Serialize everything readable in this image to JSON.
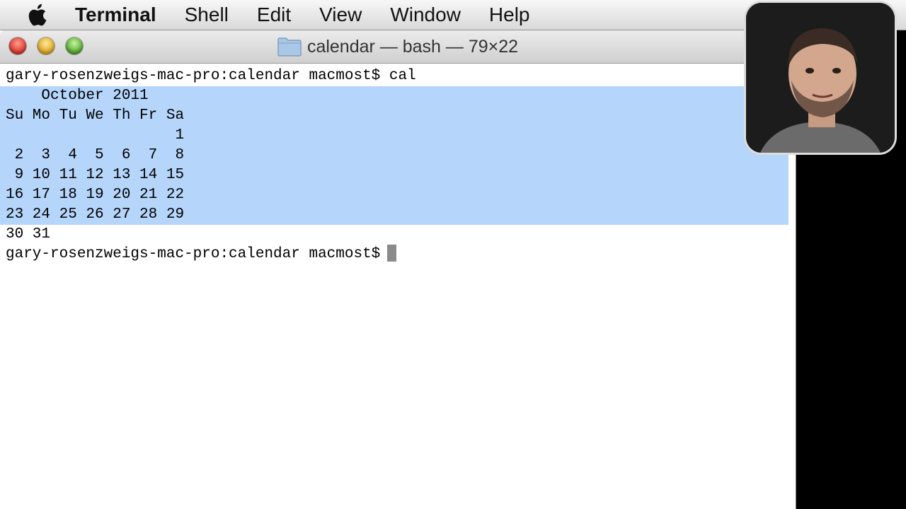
{
  "menubar": {
    "app_name": "Terminal",
    "items": [
      "Shell",
      "Edit",
      "View",
      "Window",
      "Help"
    ]
  },
  "window": {
    "title": "calendar — bash — 79×22"
  },
  "terminal": {
    "prompt": "gary-rosenzweigs-mac-pro:calendar macmost$",
    "command": " cal",
    "calendar_lines": [
      "    October 2011",
      "Su Mo Tu We Th Fr Sa",
      "                   1",
      " 2  3  4  5  6  7  8",
      " 9 10 11 12 13 14 15",
      "16 17 18 19 20 21 22",
      "23 24 25 26 27 28 29",
      "30 31"
    ],
    "prompt2": "gary-rosenzweigs-mac-pro:calendar macmost$"
  },
  "colors": {
    "selection": "#b5d5fb",
    "cursor": "#8a8a8a"
  },
  "icons": {
    "apple": "apple-logo-icon",
    "folder": "folder-icon"
  }
}
